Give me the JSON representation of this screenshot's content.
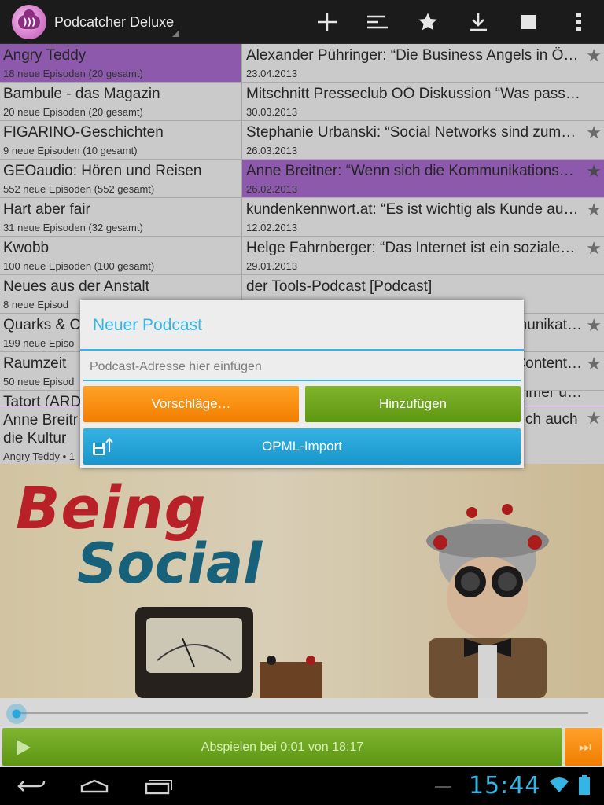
{
  "app": {
    "title": "Podcatcher Deluxe"
  },
  "actionbar": {
    "icons": [
      "add-icon",
      "sort-icon",
      "star-icon",
      "download-icon",
      "stop-icon",
      "overflow-menu-icon"
    ]
  },
  "podcasts": [
    {
      "title": "Angry Teddy",
      "subtitle": "18 neue Episoden (20 gesamt)",
      "selected": true
    },
    {
      "title": "Bambule - das Magazin",
      "subtitle": "20 neue Episoden (20 gesamt)"
    },
    {
      "title": "FIGARINO-Geschichten",
      "subtitle": "9 neue Episoden (10 gesamt)"
    },
    {
      "title": "GEOaudio: Hören und Reisen",
      "subtitle": "552 neue Episoden (552 gesamt)"
    },
    {
      "title": "Hart aber fair",
      "subtitle": "31 neue Episoden (32 gesamt)"
    },
    {
      "title": "Kwobb",
      "subtitle": "100 neue Episoden (100 gesamt)"
    },
    {
      "title": "Neues aus der Anstalt",
      "subtitle": "8 neue Episod"
    },
    {
      "title": "Quarks & C",
      "subtitle": "199 neue Episo"
    },
    {
      "title": "Raumzeit",
      "subtitle": "50 neue Episod"
    },
    {
      "title": "Tatort (ARD",
      "subtitle": ""
    }
  ],
  "episodes": [
    {
      "title": "Alexander Pühringer: “Die Business Angels in Ö…",
      "date": "23.04.2013",
      "starred": true
    },
    {
      "title": "Mitschnitt Presseclub OÖ Diskussion “Was passie…",
      "date": "30.03.2013",
      "starred": false
    },
    {
      "title": "Stephanie Urbanski: “Social Networks sind zum…",
      "date": "26.03.2013",
      "starred": true
    },
    {
      "title": "Anne Breitner: “Wenn sich die Kommunikations…",
      "date": "26.02.2013",
      "starred": true,
      "selected": true
    },
    {
      "title": "kundenkennwort.at: “Es ist wichtig als Kunde au…",
      "date": "12.02.2013",
      "starred": true
    },
    {
      "title": "Helge Fahrnberger: “Das Internet ist ein soziale…",
      "date": "29.01.2013",
      "starred": true
    },
    {
      "title": "der Tools-Podcast [Podcast]",
      "date": "",
      "starred": false
    },
    {
      "title": "nunikat…",
      "date": "",
      "starred": true
    },
    {
      "title": "Content…",
      "date": "",
      "starred": true
    },
    {
      "title": "nmer u…",
      "date": "",
      "starred": false
    }
  ],
  "now_playing": {
    "title": "Anne Breitr… ch auch die Kultur”",
    "title_left": "Anne Breitr",
    "title_left_line2": "die Kultur",
    "title_right": "ch auch",
    "meta": "Angry Teddy • 1"
  },
  "cover": {
    "line1": "Being",
    "line2": "Social"
  },
  "player": {
    "progress_fraction": 0.001,
    "play_label": "Abspielen bei 0:01 von 18:17",
    "next_icon": "⏭"
  },
  "dialog": {
    "title": "Neuer Podcast",
    "url_placeholder": "Podcast-Adresse hier einfügen",
    "url_value": "",
    "suggest_label": "Vorschläge…",
    "add_label": "Hinzufügen",
    "opml_label": "OPML-Import"
  },
  "system": {
    "clock": "15:44"
  },
  "colors": {
    "accent": "#33b5e5",
    "selection": "#a066c4",
    "orange": "#f27e00",
    "green": "#5e9711"
  }
}
